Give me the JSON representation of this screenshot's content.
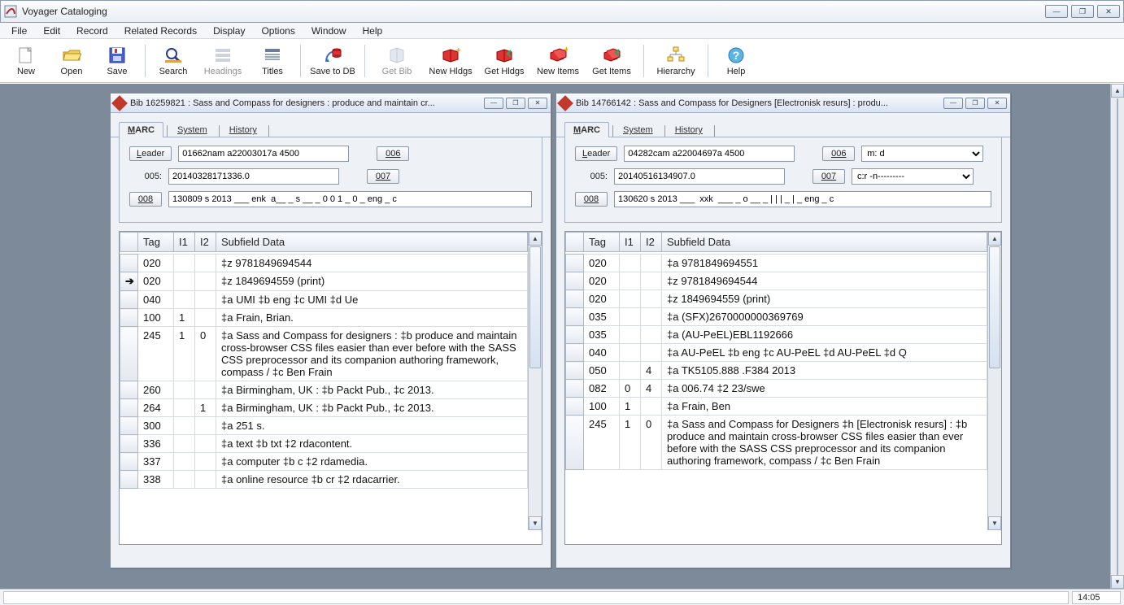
{
  "app": {
    "title": "Voyager Cataloging"
  },
  "menus": [
    "File",
    "Edit",
    "Record",
    "Related Records",
    "Display",
    "Options",
    "Window",
    "Help"
  ],
  "toolbar": [
    {
      "label": "New",
      "icon": "new",
      "enabled": true
    },
    {
      "label": "Open",
      "icon": "open",
      "enabled": true
    },
    {
      "label": "Save",
      "icon": "save",
      "enabled": true
    },
    {
      "sep": true
    },
    {
      "label": "Search",
      "icon": "search",
      "enabled": true
    },
    {
      "label": "Headings",
      "icon": "headings",
      "enabled": false
    },
    {
      "label": "Titles",
      "icon": "titles",
      "enabled": true
    },
    {
      "sep": true
    },
    {
      "label": "Save to DB",
      "icon": "savedb",
      "enabled": true
    },
    {
      "sep": true
    },
    {
      "label": "Get Bib",
      "icon": "getbib",
      "enabled": false
    },
    {
      "label": "New Hldgs",
      "icon": "newhldgs",
      "enabled": true
    },
    {
      "label": "Get Hldgs",
      "icon": "gethldgs",
      "enabled": true
    },
    {
      "label": "New Items",
      "icon": "newitems",
      "enabled": true
    },
    {
      "label": "Get Items",
      "icon": "getitems",
      "enabled": true
    },
    {
      "sep": true
    },
    {
      "label": "Hierarchy",
      "icon": "hierarchy",
      "enabled": true
    },
    {
      "sep": true
    },
    {
      "label": "Help",
      "icon": "help",
      "enabled": true
    }
  ],
  "left": {
    "title": "Bib 16259821 : Sass and Compass for designers : produce and maintain cr...",
    "tabs": [
      "MARC",
      "System",
      "History"
    ],
    "leader_btn": "Leader",
    "leader_val": "01662nam a22003017a 4500",
    "btn_006": "006",
    "btn_007": "007",
    "btn_008": "008",
    "lbl_005": "005:",
    "val_005": "20140328171336.0",
    "val_008": "130809 s 2013 ___ enk  a__ _ s __ _ 0 0 1 _ 0 _ eng _ c",
    "cols": [
      "",
      "Tag",
      "I1",
      "I2",
      "Subfield Data"
    ],
    "rows": [
      {
        "sel": "",
        "tag": "020",
        "i1": "",
        "i2": "",
        "data": "‡z 9781849694544"
      },
      {
        "sel": "➔",
        "tag": "020",
        "i1": "",
        "i2": "",
        "data": "‡z 1849694559 (print)"
      },
      {
        "sel": "",
        "tag": "040",
        "i1": "",
        "i2": "",
        "data": "‡a UMI ‡b eng ‡c UMI ‡d Ue"
      },
      {
        "sel": "",
        "tag": "100",
        "i1": "1",
        "i2": "",
        "data": "‡a Frain, Brian."
      },
      {
        "sel": "",
        "tag": "245",
        "i1": "1",
        "i2": "0",
        "data": "‡a Sass and Compass for designers  : ‡b produce and maintain cross-browser CSS files easier than ever before with the SASS CSS preprocessor and its companion authoring framework, compass / ‡c Ben Frain"
      },
      {
        "sel": "",
        "tag": "260",
        "i1": "",
        "i2": "",
        "data": "‡a Birmingham, UK : ‡b Packt Pub., ‡c 2013."
      },
      {
        "sel": "",
        "tag": "264",
        "i1": "",
        "i2": "1",
        "data": "‡a Birmingham, UK : ‡b Packt Pub., ‡c 2013."
      },
      {
        "sel": "",
        "tag": "300",
        "i1": "",
        "i2": "",
        "data": "‡a 251 s."
      },
      {
        "sel": "",
        "tag": "336",
        "i1": "",
        "i2": "",
        "data": "‡a text ‡b txt ‡2 rdacontent."
      },
      {
        "sel": "",
        "tag": "337",
        "i1": "",
        "i2": "",
        "data": "‡a computer ‡b c ‡2 rdamedia."
      },
      {
        "sel": "",
        "tag": "338",
        "i1": "",
        "i2": "",
        "data": "‡a online resource ‡b cr ‡2 rdacarrier."
      }
    ]
  },
  "right": {
    "title": "Bib 14766142 : Sass and Compass for Designers [Electronisk resurs] : produ...",
    "tabs": [
      "MARC",
      "System",
      "History"
    ],
    "leader_btn": "Leader",
    "leader_val": "04282cam a22004697a 4500",
    "btn_006": "006",
    "sel_006": "m:       d",
    "btn_007": "007",
    "sel_007": "c:r -n---------",
    "btn_008": "008",
    "lbl_005": "005:",
    "val_005": "20140516134907.0",
    "val_008": "130620 s 2013 ___  xxk  ___ _ o __ _ | | | _ | _ eng _ c",
    "cols": [
      "",
      "Tag",
      "I1",
      "I2",
      "Subfield Data"
    ],
    "rows": [
      {
        "sel": "",
        "tag": "020",
        "i1": "",
        "i2": "",
        "data": "‡a 9781849694551"
      },
      {
        "sel": "",
        "tag": "020",
        "i1": "",
        "i2": "",
        "data": "‡z 9781849694544"
      },
      {
        "sel": "",
        "tag": "020",
        "i1": "",
        "i2": "",
        "data": "‡z 1849694559 (print)"
      },
      {
        "sel": "",
        "tag": "035",
        "i1": "",
        "i2": "",
        "data": "‡a (SFX)2670000000369769"
      },
      {
        "sel": "",
        "tag": "035",
        "i1": "",
        "i2": "",
        "data": "‡a (AU-PeEL)EBL1192666"
      },
      {
        "sel": "",
        "tag": "040",
        "i1": "",
        "i2": "",
        "data": "‡a AU-PeEL ‡b eng ‡c AU-PeEL ‡d AU-PeEL ‡d Q"
      },
      {
        "sel": "",
        "tag": "050",
        "i1": "",
        "i2": "4",
        "data": "‡a TK5105.888 .F384 2013"
      },
      {
        "sel": "",
        "tag": "082",
        "i1": "0",
        "i2": "4",
        "data": "‡a 006.74 ‡2 23/swe"
      },
      {
        "sel": "",
        "tag": "100",
        "i1": "1",
        "i2": "",
        "data": "‡a Frain, Ben"
      },
      {
        "sel": "",
        "tag": "245",
        "i1": "1",
        "i2": "0",
        "data": "‡a Sass and Compass for Designers ‡h [Electronisk resurs] : ‡b produce and maintain cross-browser CSS files easier than ever before with the SASS CSS preprocessor and its companion authoring framework, compass / ‡c Ben Frain"
      }
    ]
  },
  "status": {
    "time": "14:05"
  }
}
